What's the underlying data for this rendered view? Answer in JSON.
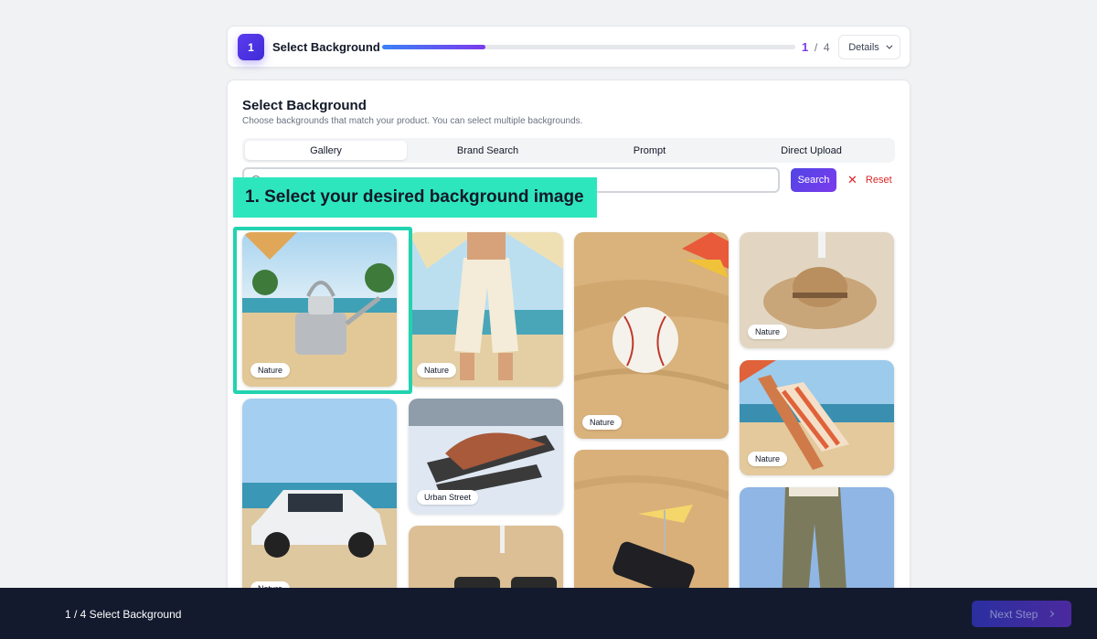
{
  "header": {
    "step_number": "1",
    "step_title": "Select Background",
    "progress_fraction": 0.25,
    "current_step": "1",
    "separator": "/",
    "total_steps": "4",
    "details_label": "Details"
  },
  "main": {
    "title": "Select Background",
    "subtitle": "Choose backgrounds that match your product. You can select multiple backgrounds.",
    "tabs": [
      {
        "label": "Gallery",
        "active": true
      },
      {
        "label": "Brand Search",
        "active": false
      },
      {
        "label": "Prompt",
        "active": false
      },
      {
        "label": "Direct Upload",
        "active": false
      }
    ],
    "search": {
      "placeholder": "",
      "value": ""
    },
    "search_label": "Search",
    "reset_label": "Reset",
    "gallery": [
      {
        "tag": "Nature",
        "scene": "watering can on beach"
      },
      {
        "tag": "Nature",
        "scene": "linen pants on beach"
      },
      {
        "tag": "Nature",
        "scene": "baseball in sand"
      },
      {
        "tag": "Nature",
        "scene": "straw hat on sand"
      },
      {
        "tag": "Nature",
        "scene": "beach chair"
      },
      {
        "tag": "Nature",
        "scene": "suv on beach"
      },
      {
        "tag": "Urban Street",
        "scene": "sandals in snow"
      },
      {
        "tag": "",
        "scene": "sunglasses on sand"
      },
      {
        "tag": "",
        "scene": "phone with umbrella on sand"
      },
      {
        "tag": "",
        "scene": "olive cargo pants"
      }
    ]
  },
  "overlay": {
    "callout_text": "1. Select your desired background image"
  },
  "footer": {
    "label": "1 / 4 Select Background",
    "next_label": "Next Step"
  },
  "colors": {
    "accent": "#7c3aed",
    "highlight": "#2ee6bd",
    "footer_bg": "#141a2e",
    "reset": "#dc2626"
  }
}
